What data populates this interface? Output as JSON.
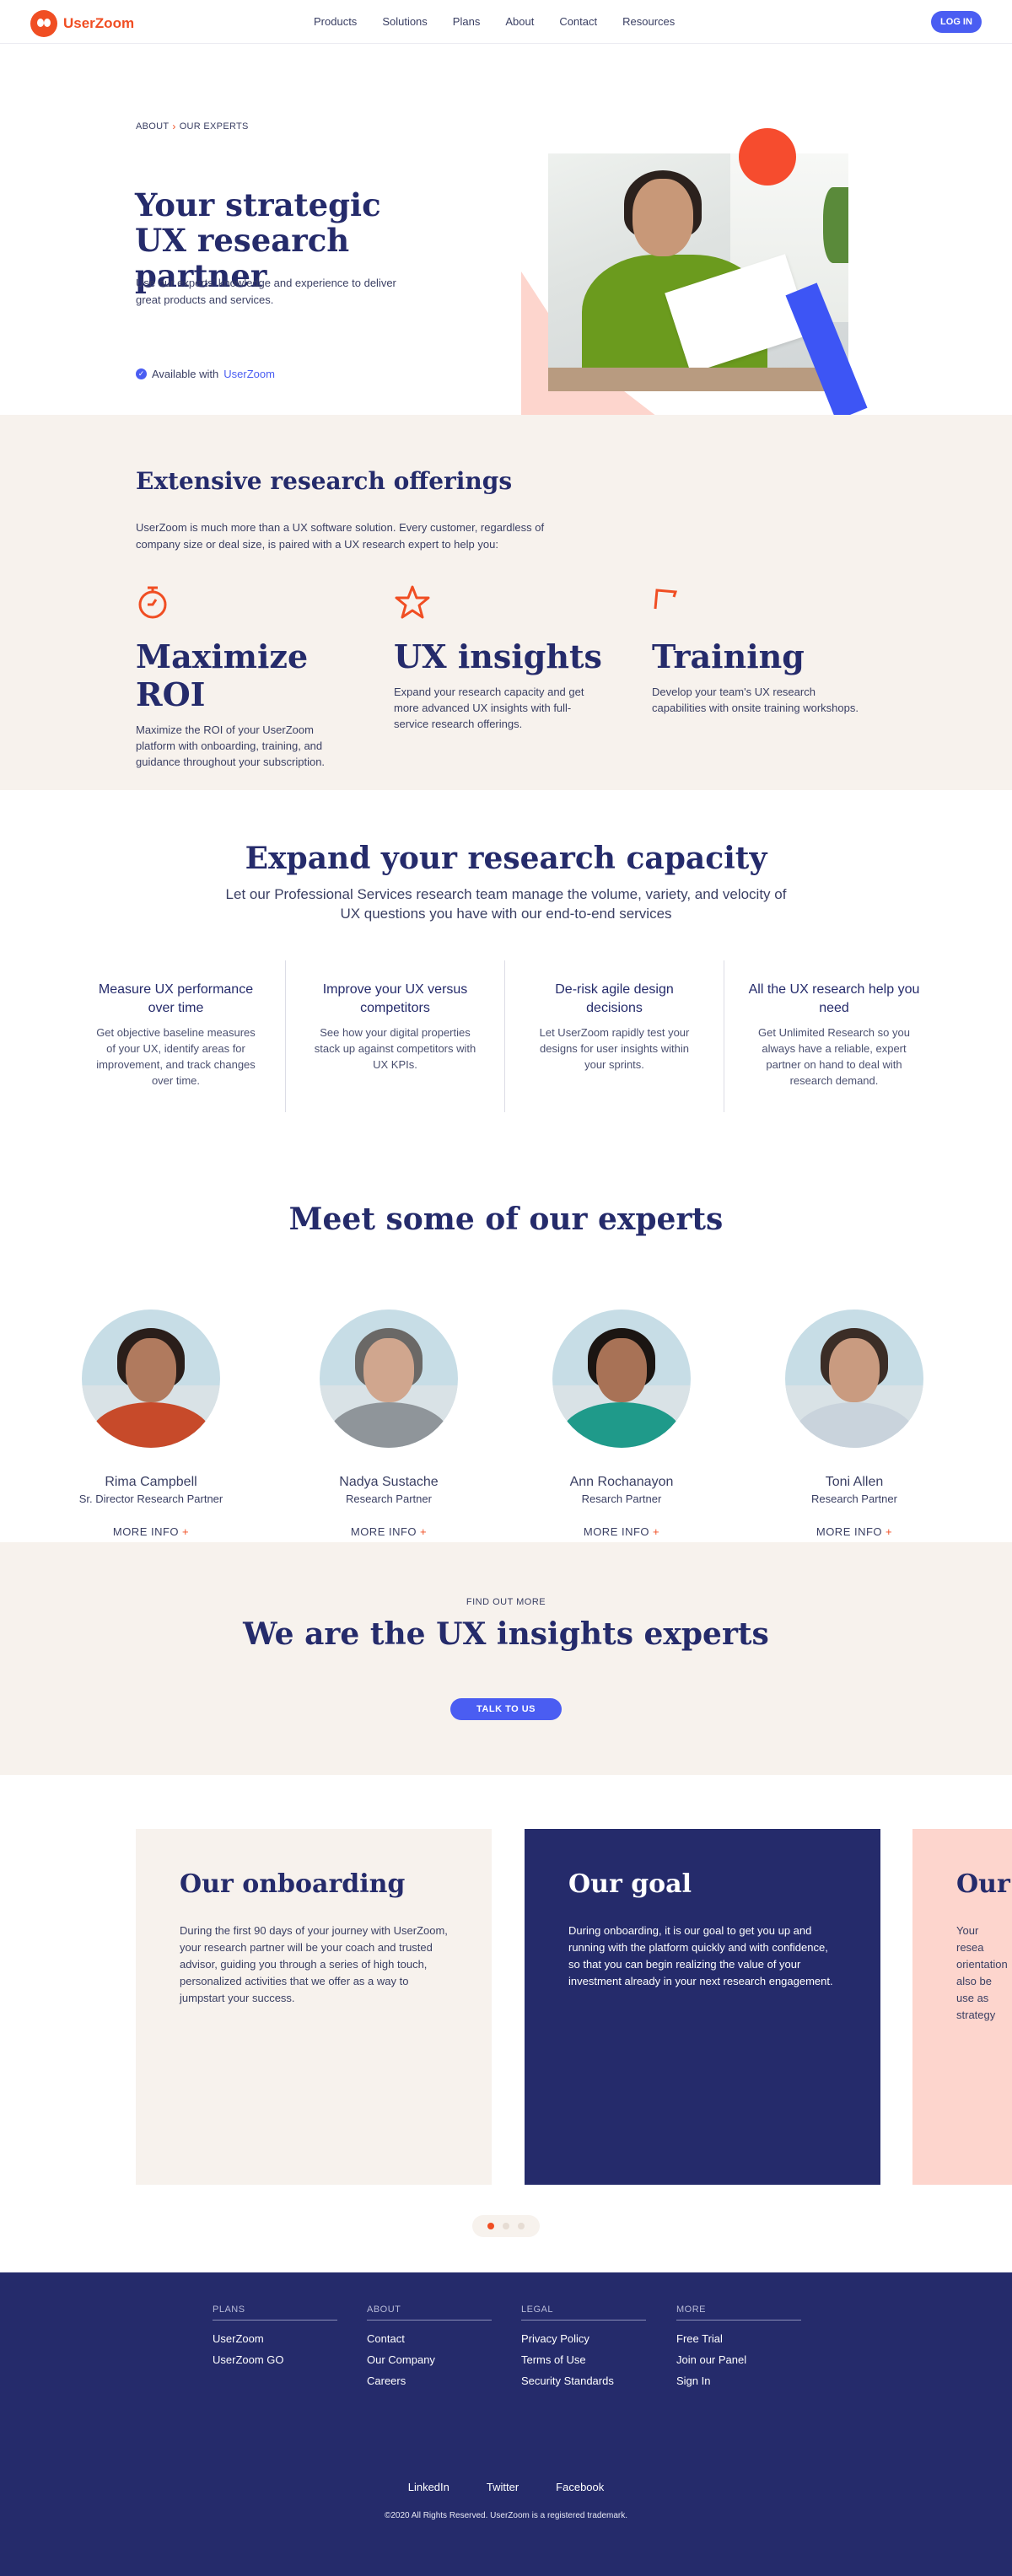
{
  "brand": {
    "name": "UserZoom",
    "accent": "#f04e23",
    "primary": "#4a5df2",
    "navy": "#252b6b"
  },
  "header": {
    "nav": [
      "Products",
      "Solutions",
      "Plans",
      "About",
      "Contact",
      "Resources"
    ],
    "login": "LOG IN"
  },
  "hero": {
    "breadcrumb": [
      "ABOUT",
      "OUR EXPERTS"
    ],
    "title": "Your strategic UX research partner",
    "subtitle": "Use our experts' knowledge and experience to deliver great products and services.",
    "available_prefix": "Available with",
    "available_link": "UserZoom"
  },
  "offerings": {
    "title": "Extensive research offerings",
    "intro": "UserZoom is much more than a UX software solution. Every customer, regardless of company size or deal size, is paired with a UX research expert to help you:",
    "items": [
      {
        "icon": "stopwatch-icon",
        "title": "Maximize ROI",
        "text": "Maximize the ROI of your UserZoom platform with onboarding, training, and guidance throughout your subscription."
      },
      {
        "icon": "star-icon",
        "title": "UX insights",
        "text": "Expand your research capacity and get more advanced UX insights with full-service research offerings."
      },
      {
        "icon": "flag-icon",
        "title": "Training",
        "text": "Develop your team's UX research capabilities with onsite training workshops."
      }
    ]
  },
  "capacity": {
    "title": "Expand your research capacity",
    "lead": "Let our Professional Services research team manage the volume, variety, and velocity of UX questions you have with our end-to-end services",
    "items": [
      {
        "title": "Measure UX performance over time",
        "text": "Get objective baseline measures of your UX, identify areas for improvement, and track changes over time."
      },
      {
        "title": "Improve your UX versus competitors",
        "text": "See how your digital properties stack up against competitors with UX KPIs."
      },
      {
        "title": "De-risk agile design decisions",
        "text": "Let UserZoom rapidly test your designs for user insights within your sprints."
      },
      {
        "title": "All the UX research help you need",
        "text": "Get Unlimited Research so you always have a reliable, expert partner on hand to deal with research demand."
      }
    ]
  },
  "experts": {
    "title": "Meet some of our experts",
    "more_label": "MORE INFO",
    "people": [
      {
        "name": "Rima Campbell",
        "role": "Sr. Director Research Partner",
        "shirt": "#c74a2a",
        "hair": "#2a1e1a",
        "skin": "#b07a5e"
      },
      {
        "name": "Nadya Sustache",
        "role": "Research Partner",
        "shirt": "#8f959a",
        "hair": "#6a6866",
        "skin": "#d0a68e"
      },
      {
        "name": "Ann Rochanayon",
        "role": "Resarch Partner",
        "shirt": "#1f9a8a",
        "hair": "#1b1512",
        "skin": "#a87256"
      },
      {
        "name": "Toni Allen",
        "role": "Research Partner",
        "shirt": "#c9d3dc",
        "hair": "#3b2d26",
        "skin": "#c99b80"
      }
    ]
  },
  "cta": {
    "eyebrow": "FIND OUT MORE",
    "title": "We are the UX insights experts",
    "button": "TALK TO US"
  },
  "carousel": {
    "cards": [
      {
        "title": "Our onboarding",
        "text": "During the first 90 days of your journey with UserZoom, your research partner will be your coach and trusted advisor, guiding you through a series of high touch, personalized activities that we offer as a way to jumpstart your success."
      },
      {
        "title": "Our goal",
        "text": "During onboarding, it is our goal to get you up and running with the platform quickly and with confidence, so that you can begin realizing the value of your investment already in your next research engagement."
      },
      {
        "title": "Our t",
        "text": "Your resea orientation also be use as strategy"
      }
    ],
    "active_index": 0,
    "count": 3
  },
  "footer": {
    "columns": [
      {
        "heading": "PLANS",
        "links": [
          "UserZoom",
          "UserZoom GO"
        ]
      },
      {
        "heading": "ABOUT",
        "links": [
          "Contact",
          "Our Company",
          "Careers"
        ]
      },
      {
        "heading": "LEGAL",
        "links": [
          "Privacy Policy",
          "Terms of Use",
          "Security Standards"
        ]
      },
      {
        "heading": "MORE",
        "links": [
          "Free Trial",
          "Join our Panel",
          "Sign In"
        ]
      }
    ],
    "social": [
      "LinkedIn",
      "Twitter",
      "Facebook"
    ],
    "copyright": "©2020 All Rights Reserved. UserZoom is a registered trademark."
  }
}
